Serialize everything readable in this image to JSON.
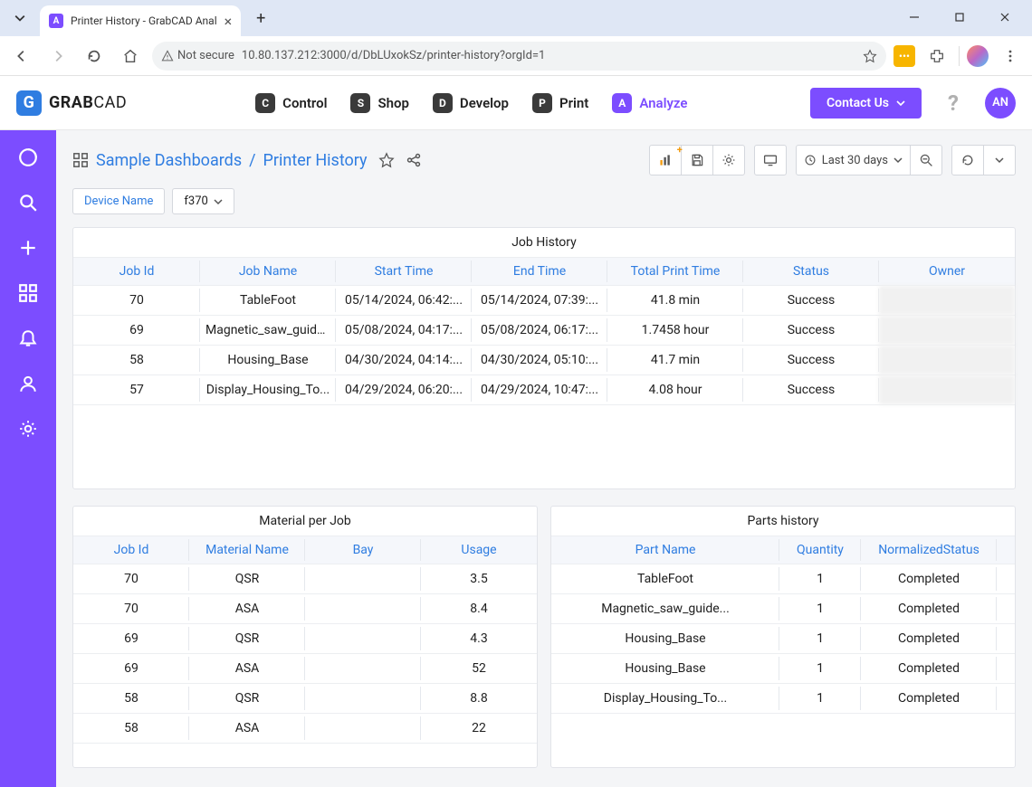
{
  "browser": {
    "tab_title": "Printer History - GrabCAD Anal",
    "not_secure": "Not secure",
    "url": "10.80.137.212:3000/d/DbLUxokSz/printer-history?orgId=1"
  },
  "topnav": {
    "brand_left": "GRAB",
    "brand_right": "CAD",
    "links": {
      "control": "Control",
      "shop": "Shop",
      "develop": "Develop",
      "print": "Print",
      "analyze": "Analyze"
    },
    "contact": "Contact Us",
    "avatar": "AN"
  },
  "page": {
    "breadcrumb_folder": "Sample Dashboards",
    "breadcrumb_page": "Printer History",
    "time_range": "Last 30 days",
    "filter_label": "Device Name",
    "filter_value": "f370"
  },
  "job_history": {
    "title": "Job History",
    "headers": [
      "Job Id",
      "Job Name",
      "Start Time",
      "End Time",
      "Total Print Time",
      "Status",
      "Owner"
    ],
    "rows": [
      {
        "c0": "70",
        "c1": "TableFoot",
        "c2": "05/14/2024, 06:42:...",
        "c3": "05/14/2024, 07:39:...",
        "c4": "41.8 min",
        "c5": "Success",
        "c6": ""
      },
      {
        "c0": "69",
        "c1": "Magnetic_saw_guide...",
        "c2": "05/08/2024, 04:17:...",
        "c3": "05/08/2024, 06:17:...",
        "c4": "1.7458 hour",
        "c5": "Success",
        "c6": ""
      },
      {
        "c0": "58",
        "c1": "Housing_Base",
        "c2": "04/30/2024, 04:14:...",
        "c3": "04/30/2024, 05:10:...",
        "c4": "41.7 min",
        "c5": "Success",
        "c6": ""
      },
      {
        "c0": "57",
        "c1": "Display_Housing_To...",
        "c2": "04/29/2024, 06:20:...",
        "c3": "04/29/2024, 10:47:...",
        "c4": "4.08 hour",
        "c5": "Success",
        "c6": ""
      }
    ]
  },
  "material": {
    "title": "Material per Job",
    "headers": [
      "Job Id",
      "Material Name",
      "Bay",
      "Usage"
    ],
    "rows": [
      {
        "c0": "70",
        "c1": "QSR",
        "c2": "",
        "c3": "3.5"
      },
      {
        "c0": "70",
        "c1": "ASA",
        "c2": "",
        "c3": "8.4"
      },
      {
        "c0": "69",
        "c1": "QSR",
        "c2": "",
        "c3": "4.3"
      },
      {
        "c0": "69",
        "c1": "ASA",
        "c2": "",
        "c3": "52"
      },
      {
        "c0": "58",
        "c1": "QSR",
        "c2": "",
        "c3": "8.8"
      },
      {
        "c0": "58",
        "c1": "ASA",
        "c2": "",
        "c3": "22"
      }
    ]
  },
  "parts": {
    "title": "Parts history",
    "headers": [
      "Part Name",
      "Quantity",
      "NormalizedStatus",
      ""
    ],
    "rows": [
      {
        "c0": "TableFoot",
        "c1": "1",
        "c2": "Completed",
        "c3": ""
      },
      {
        "c0": "Magnetic_saw_guide...",
        "c1": "1",
        "c2": "Completed",
        "c3": ""
      },
      {
        "c0": "Housing_Base",
        "c1": "1",
        "c2": "Completed",
        "c3": ""
      },
      {
        "c0": "Housing_Base",
        "c1": "1",
        "c2": "Completed",
        "c3": ""
      },
      {
        "c0": "Display_Housing_To...",
        "c1": "1",
        "c2": "Completed",
        "c3": ""
      }
    ]
  }
}
